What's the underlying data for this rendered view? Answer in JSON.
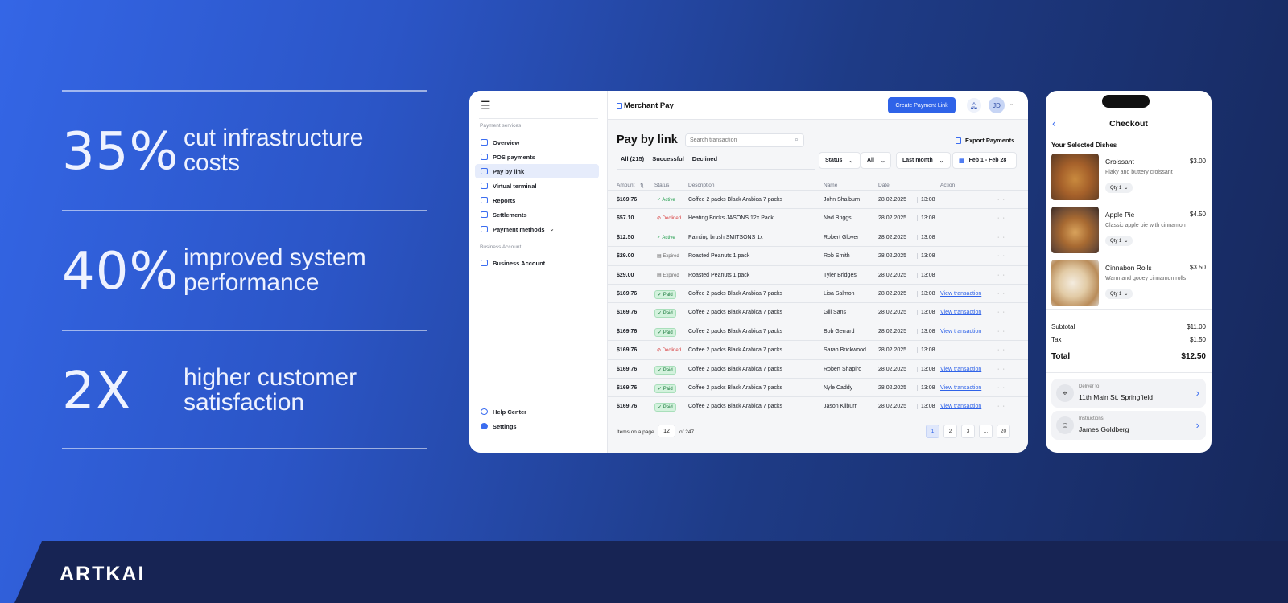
{
  "stats": [
    {
      "value": "35%",
      "text": "cut infrastructure costs"
    },
    {
      "value": "40%",
      "text": "improved system performance"
    },
    {
      "value": "2X",
      "text": "higher customer satisfaction"
    }
  ],
  "footer": {
    "logo": "ARTKAI"
  },
  "dashboard": {
    "sidebar": {
      "menu_icon": "☰",
      "section1": "Payment services",
      "items": [
        "Overview",
        "POS payments",
        "Pay by link",
        "Virtual terminal",
        "Reports",
        "Settlements",
        "Payment methods"
      ],
      "section2": "Business Account",
      "business": "Business Account",
      "help": "Help Center",
      "settings": "Settings"
    },
    "header": {
      "brand": "Merchant Pay",
      "cta": "Create Payment Link",
      "avatar": "JD"
    },
    "page": {
      "title": "Pay by link",
      "search_placeholder": "Search transaction",
      "export": "Export Payments",
      "tabs": [
        "All (215)",
        "Successful",
        "Declined"
      ],
      "filters": {
        "status": "Status",
        "all": "All",
        "period": "Last month",
        "range": "Feb 1 - Feb 28"
      }
    },
    "columns": [
      "Amount",
      "Status",
      "Description",
      "Name",
      "Date",
      "Action"
    ],
    "rows": [
      {
        "amount": "$169.76",
        "status": "Active",
        "desc": "Coffee 2 packs Black Arabica 7 packs",
        "name": "John Shalburn",
        "date": "28.02.2025",
        "time": "13:08",
        "action": ""
      },
      {
        "amount": "$57.10",
        "status": "Declined",
        "desc": "Heating Bricks JASONS 12x Pack",
        "name": "Nad Briggs",
        "date": "28.02.2025",
        "time": "13:08",
        "action": ""
      },
      {
        "amount": "$12.50",
        "status": "Active",
        "desc": "Painting brush SMITSONS 1x",
        "name": "Robert Glover",
        "date": "28.02.2025",
        "time": "13:08",
        "action": ""
      },
      {
        "amount": "$29.00",
        "status": "Expired",
        "desc": "Roasted Peanuts 1 pack",
        "name": "Rob Smith",
        "date": "28.02.2025",
        "time": "13:08",
        "action": ""
      },
      {
        "amount": "$29.00",
        "status": "Expired",
        "desc": "Roasted Peanuts 1 pack",
        "name": "Tyler Bridges",
        "date": "28.02.2025",
        "time": "13:08",
        "action": ""
      },
      {
        "amount": "$169.76",
        "status": "Paid",
        "desc": "Coffee 2 packs Black Arabica 7 packs",
        "name": "Lisa Salmon",
        "date": "28.02.2025",
        "time": "13:08",
        "action": "View transaction"
      },
      {
        "amount": "$169.76",
        "status": "Paid",
        "desc": "Coffee 2 packs Black Arabica 7 packs",
        "name": "Gill Sans",
        "date": "28.02.2025",
        "time": "13:08",
        "action": "View transaction"
      },
      {
        "amount": "$169.76",
        "status": "Paid",
        "desc": "Coffee 2 packs Black Arabica 7 packs",
        "name": "Bob Gerrard",
        "date": "28.02.2025",
        "time": "13:08",
        "action": "View transaction"
      },
      {
        "amount": "$169.76",
        "status": "Declined",
        "desc": "Coffee 2 packs Black Arabica 7 packs",
        "name": "Sarah Brickwood",
        "date": "28.02.2025",
        "time": "13:08",
        "action": ""
      },
      {
        "amount": "$169.76",
        "status": "Paid",
        "desc": "Coffee 2 packs Black Arabica 7 packs",
        "name": "Robert Shapiro",
        "date": "28.02.2025",
        "time": "13:08",
        "action": "View transaction"
      },
      {
        "amount": "$169.76",
        "status": "Paid",
        "desc": "Coffee 2 packs Black Arabica 7 packs",
        "name": "Nyle Caddy",
        "date": "28.02.2025",
        "time": "13:08",
        "action": "View transaction"
      },
      {
        "amount": "$169.76",
        "status": "Paid",
        "desc": "Coffee 2 packs Black Arabica 7 packs",
        "name": "Jason Kilburn",
        "date": "28.02.2025",
        "time": "13:08",
        "action": "View transaction"
      }
    ],
    "pagination": {
      "label": "Items on a page",
      "per_page": "12",
      "of": "of 247",
      "pages": [
        "1",
        "2",
        "3",
        "...",
        "20"
      ],
      "current": "1"
    }
  },
  "checkout": {
    "title": "Checkout",
    "section": "Your Selected Dishes",
    "dishes": [
      {
        "name": "Croissant",
        "price": "$3.00",
        "desc": "Flaky and buttery croissant",
        "qty": "Qty 1"
      },
      {
        "name": "Apple Pie",
        "price": "$4.50",
        "desc": "Classic apple pie with cinnamon",
        "qty": "Qty 1"
      },
      {
        "name": "Cinnabon Rolls",
        "price": "$3.50",
        "desc": "Warm and gooey cinnamon rolls",
        "qty": "Qty 1"
      }
    ],
    "subtotal_label": "Subtotal",
    "subtotal": "$11.00",
    "tax_label": "Tax",
    "tax": "$1.50",
    "total_label": "Total",
    "total": "$12.50",
    "deliver_label": "Deliver to",
    "deliver": "11th Main St, Springfield",
    "instr_label": "Instructions",
    "instr": "James Goldberg"
  },
  "colors": {
    "accent": "#2f63e8",
    "paid_bg": "#d3f2dd",
    "declined": "#d73a3a",
    "active": "#1e9c4a"
  }
}
